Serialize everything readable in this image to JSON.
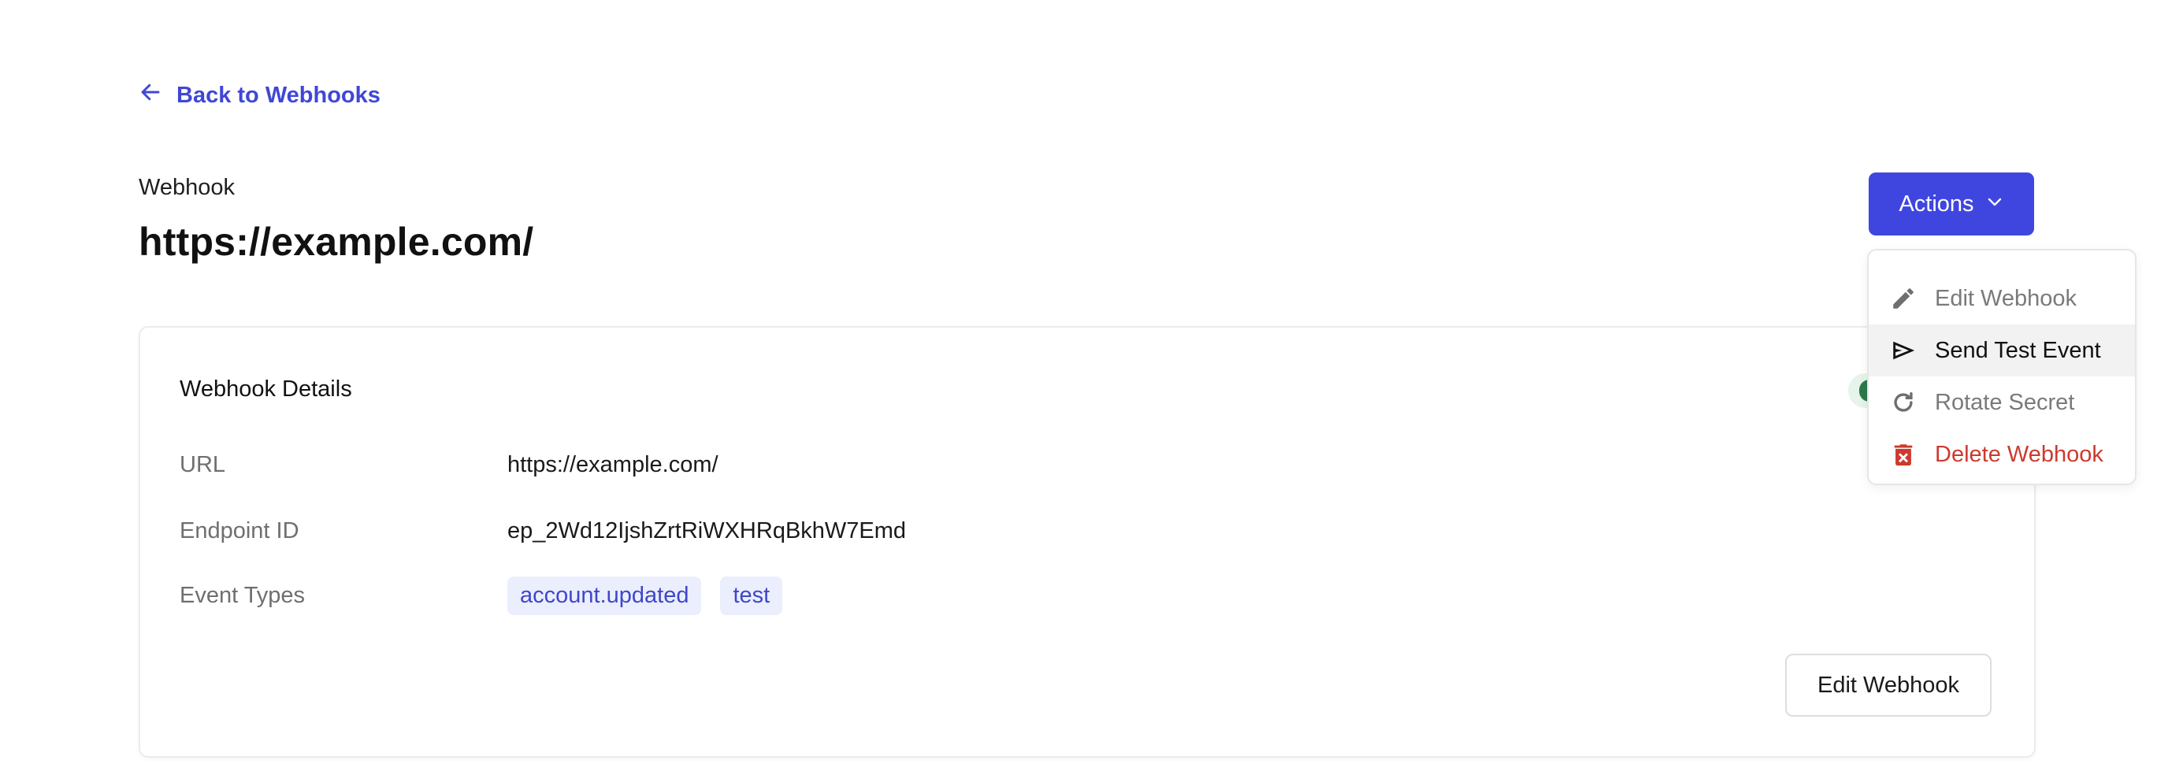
{
  "nav": {
    "back_label": "Back to Webhooks"
  },
  "header": {
    "eyebrow": "Webhook",
    "title": "https://example.com/"
  },
  "actions": {
    "button_label": "Actions",
    "menu": [
      {
        "label": "Edit Webhook",
        "icon": "pencil-icon",
        "state": "default"
      },
      {
        "label": "Send Test Event",
        "icon": "send-icon",
        "state": "hovered"
      },
      {
        "label": "Rotate Secret",
        "icon": "rotate-icon",
        "state": "default"
      },
      {
        "label": "Delete Webhook",
        "icon": "trash-icon",
        "state": "danger"
      }
    ]
  },
  "details": {
    "title": "Webhook Details",
    "rows": [
      {
        "label": "URL",
        "value": "https://example.com/"
      },
      {
        "label": "Endpoint ID",
        "value": "ep_2Wd12IjshZrtRiWXHRqBkhW7Emd"
      },
      {
        "label": "Event Types"
      }
    ],
    "event_types": [
      "account.updated",
      "test"
    ],
    "edit_button_label": "Edit Webhook"
  },
  "colors": {
    "accent": "#3f46df",
    "link": "#4047d6",
    "danger": "#cc3a2f",
    "tag_bg": "#ebeefc",
    "status_green": "#2b7a4b"
  }
}
